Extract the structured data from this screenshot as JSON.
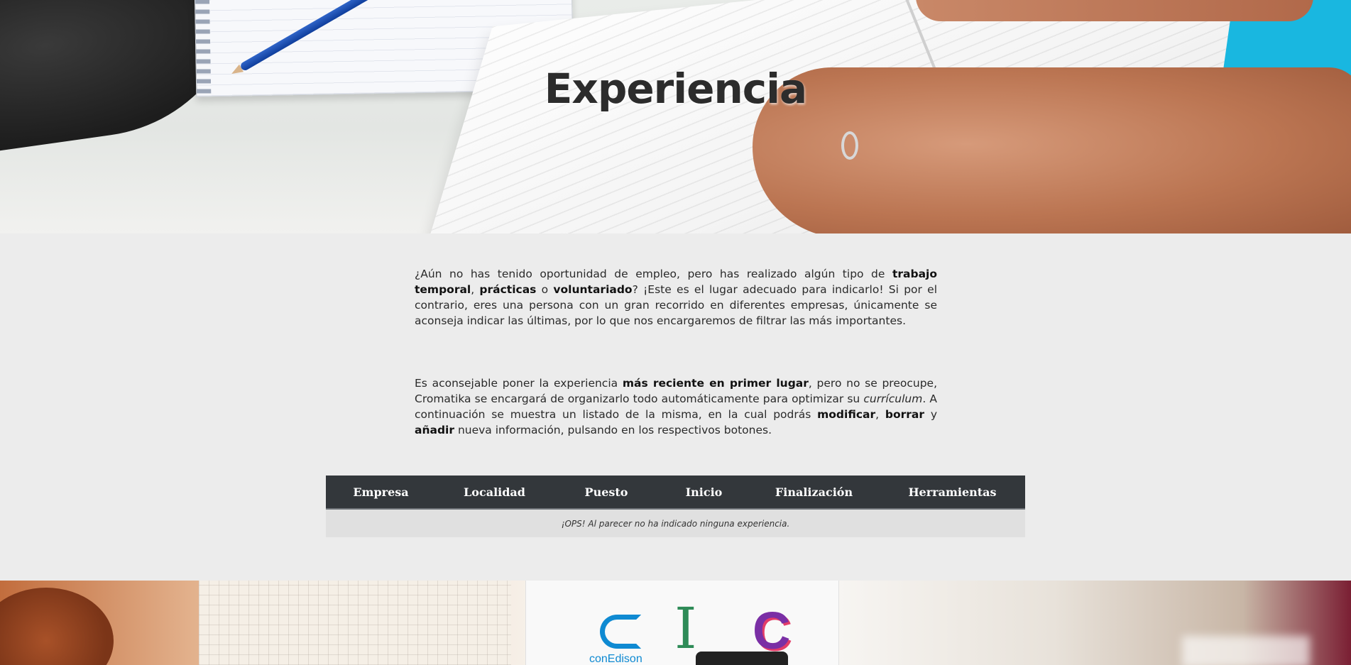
{
  "hero": {
    "title": "Experiencia"
  },
  "intro": {
    "p1": [
      {
        "t": "¿Aún no has tenido oportunidad de empleo, pero has realizado algún tipo de ",
        "b": false,
        "i": false
      },
      {
        "t": "trabajo temporal",
        "b": true,
        "i": false
      },
      {
        "t": ", ",
        "b": false,
        "i": false
      },
      {
        "t": "prácticas",
        "b": true,
        "i": false
      },
      {
        "t": " o ",
        "b": false,
        "i": false
      },
      {
        "t": "voluntariado",
        "b": true,
        "i": false
      },
      {
        "t": "? ¡Este es el lugar adecuado para indicarlo! Si por el contrario, eres una persona con un gran recorrido en diferentes empresas, únicamente se aconseja indicar las últimas, por lo que nos encargaremos de filtrar las más importantes.",
        "b": false,
        "i": false
      }
    ],
    "p2": [
      {
        "t": "Es aconsejable poner la experiencia ",
        "b": false,
        "i": false
      },
      {
        "t": "más reciente en primer lugar",
        "b": true,
        "i": false
      },
      {
        "t": ", pero no se preocupe, Cromatika se encargará de organizarlo todo automáticamente para optimizar su ",
        "b": false,
        "i": false
      },
      {
        "t": "currículum",
        "b": false,
        "i": true
      },
      {
        "t": ". A continuación se muestra un listado de la misma, en la cual podrás ",
        "b": false,
        "i": false
      },
      {
        "t": "modificar",
        "b": true,
        "i": false
      },
      {
        "t": ", ",
        "b": false,
        "i": false
      },
      {
        "t": "borrar",
        "b": true,
        "i": false
      },
      {
        "t": " y ",
        "b": false,
        "i": false
      },
      {
        "t": "añadir",
        "b": true,
        "i": false
      },
      {
        "t": " nueva información, pulsando en los respectivos botones.",
        "b": false,
        "i": false
      }
    ]
  },
  "table": {
    "headers": [
      "Empresa",
      "Localidad",
      "Puesto",
      "Inicio",
      "Finalización",
      "Herramientas"
    ],
    "empty_message": "¡OPS! Al parecer no ha indicado ninguna experiencia."
  },
  "footer_banner": {
    "logo_conedison": "conEdison",
    "logo_i": "I",
    "logo_c": "C"
  },
  "colors": {
    "page_bg": "#ececec",
    "table_header_bg": "#33373b",
    "table_row_bg": "#e0e0e0"
  }
}
